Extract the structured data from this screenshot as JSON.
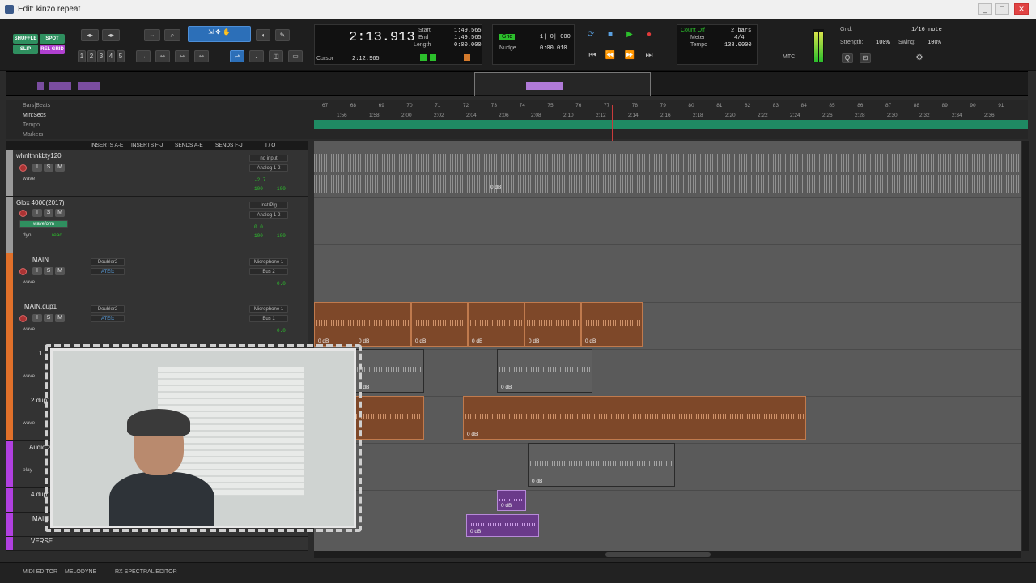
{
  "window": {
    "title": "Edit: kinzo repeat",
    "minimize": "_",
    "maximize": "□",
    "close": "✕"
  },
  "modes": {
    "shuffle": "SHUFFLE",
    "spot": "SPOT",
    "slip": "SLIP",
    "rel_grid": "REL GRID"
  },
  "toolbar": {
    "zoom_presets": [
      "1",
      "2",
      "3",
      "4",
      "5"
    ]
  },
  "counter": {
    "main": "2:13.913",
    "start_label": "Start",
    "end_label": "End",
    "length_label": "Length",
    "start": "1:49.565",
    "end": "1:49.565",
    "length": "0:00.000",
    "cursor_label": "Cursor",
    "cursor": "2:12.965"
  },
  "grid_nudge": {
    "grid_label": "Grid",
    "grid_value": "1| 0| 000",
    "nudge_label": "Nudge",
    "nudge_value": "0:00.010"
  },
  "midi_panel": {
    "count_off": "Count Off",
    "bars": "2 bars",
    "meter_label": "Meter",
    "meter": "4/4",
    "tempo_label": "Tempo",
    "tempo": "138.0000"
  },
  "grid_panel": {
    "grid_label": "Grid:",
    "grid_value": "1/16 note",
    "strength_label": "Strength:",
    "strength": "100%",
    "swing_label": "Swing:",
    "swing": "100%",
    "mtc": "MTC"
  },
  "rulers": {
    "labels": [
      "Bars|Beats",
      "Min:Secs",
      "Tempo",
      "Markers"
    ],
    "bar_ticks": [
      "67",
      "68",
      "69",
      "70",
      "71",
      "72",
      "73",
      "74",
      "75",
      "76",
      "77",
      "78",
      "79",
      "80",
      "81",
      "82",
      "83",
      "84",
      "85",
      "86",
      "87",
      "88",
      "89",
      "90",
      "91"
    ],
    "time_ticks": [
      "1:56",
      "1:58",
      "2:00",
      "2:02",
      "2:04",
      "2:06",
      "2:08",
      "2:10",
      "2:12",
      "2:14",
      "2:16",
      "2:18",
      "2:20",
      "2:22",
      "2:24",
      "2:26",
      "2:28",
      "2:30",
      "2:32",
      "2:34",
      "2:36"
    ]
  },
  "columns": {
    "inserts_ae": "INSERTS A-E",
    "inserts_fj": "INSERTS F-J",
    "sends_ae": "SENDS A-E",
    "sends_fj": "SENDS F-J",
    "io": "I / O"
  },
  "tracks": [
    {
      "name": "whnlthnkbty120",
      "input": "no input",
      "output": "Analog 1-2",
      "vol": "-2.7",
      "pan_l": "100",
      "pan_r": "100",
      "view": "wave",
      "color": "#9a9a9a"
    },
    {
      "name": "Glox 4000(2017)",
      "input": "Inst/Plg",
      "output": "Analog 1-2",
      "vol": "0.0",
      "pan_l": "100",
      "pan_r": "100",
      "view": "waveform",
      "extra": "dyn",
      "mode": "read",
      "color": "#9a9a9a"
    },
    {
      "name": "MAIN",
      "input": "Microphone 1",
      "output": "Bus 2",
      "insert1": "Doubler2",
      "insert2": "ATEfx",
      "vol": "0.0",
      "view": "wave",
      "color": "#e0702a"
    },
    {
      "name": "MAIN.dup1",
      "input": "Microphone 1",
      "output": "Bus 1",
      "insert1": "Doubler2",
      "insert2": "ATEfx",
      "vol": "0.0",
      "view": "wave",
      "color": "#e0702a"
    },
    {
      "name": "1",
      "view": "wave",
      "color": "#e0702a"
    },
    {
      "name": "2.dup1",
      "view": "wave",
      "color": "#e0702a"
    },
    {
      "name": "Audio 2",
      "view": "play",
      "color": "#b040e0"
    },
    {
      "name": "4.dup1",
      "color": "#b040e0"
    },
    {
      "name": "MAIN",
      "color": "#b040e0"
    },
    {
      "name": "VERSE",
      "color": "#b040e0"
    }
  ],
  "clips": {
    "gain": "0 dB"
  },
  "bottom": {
    "midi_editor": "MIDI EDITOR",
    "melodyne": "MELODYNE",
    "rx": "RX SPECTRAL EDITOR"
  },
  "colors": {
    "accent": "#2c6fb8",
    "tempo_ruler": "#1f8a63",
    "clip_orange": "#7e4829",
    "clip_purple": "#6a3a8a"
  }
}
